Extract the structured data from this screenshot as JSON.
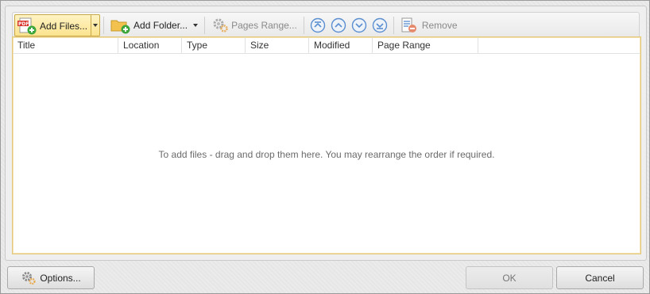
{
  "toolbar": {
    "add_files_label": "Add Files...",
    "add_folder_label": "Add Folder...",
    "pages_range_label": "Pages Range...",
    "remove_label": "Remove",
    "icons": [
      "pdf-add-icon",
      "folder-add-icon",
      "gear-icon",
      "move-top-icon",
      "move-up-icon",
      "move-down-icon",
      "move-bottom-icon",
      "remove-list-icon"
    ]
  },
  "list": {
    "columns": [
      "Title",
      "Location",
      "Type",
      "Size",
      "Modified",
      "Page Range"
    ],
    "empty_message": "To add files - drag and drop them here. You may rearrange the order if required."
  },
  "footer": {
    "options_label": "Options...",
    "ok_label": "OK",
    "cancel_label": "Cancel"
  },
  "colors": {
    "accent_active": "#fbe38e",
    "list_border": "#e3c77a",
    "nav_icon": "#5b8fd0"
  }
}
